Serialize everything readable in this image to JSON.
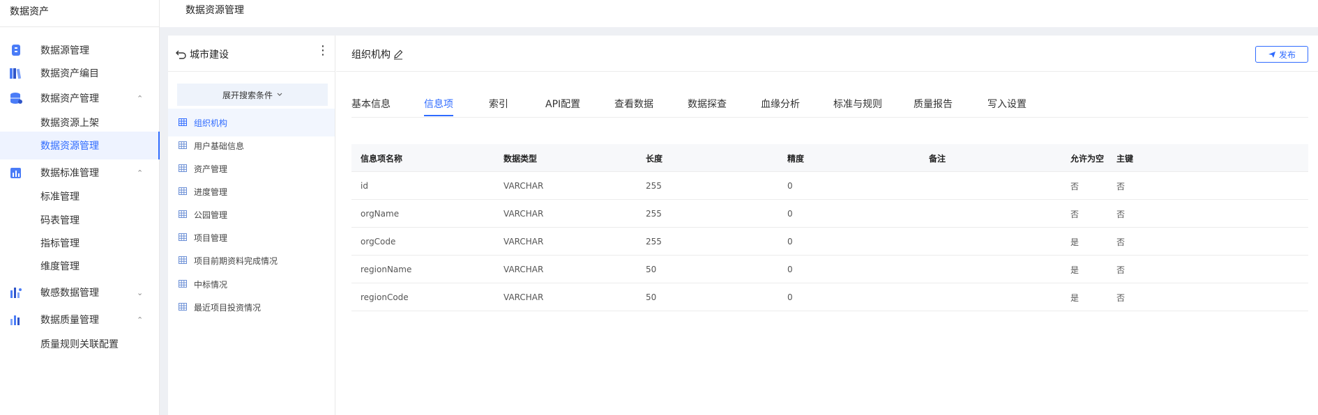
{
  "sidebar": {
    "header": "数据资产",
    "items": [
      {
        "label": "数据源管理",
        "icon": "database-server-icon",
        "arrow": ""
      },
      {
        "label": "数据资产编目",
        "icon": "catalog-books-icon",
        "arrow": ""
      },
      {
        "label": "数据资产管理",
        "icon": "database-stack-icon",
        "arrow": "⌃"
      },
      {
        "label": "数据资源上架",
        "sub": true
      },
      {
        "label": "数据资源管理",
        "sub": true,
        "active": true
      },
      {
        "label": "数据标准管理",
        "icon": "bar-chart-icon",
        "arrow": "⌃"
      },
      {
        "label": "标准管理",
        "sub": true
      },
      {
        "label": "码表管理",
        "sub": true
      },
      {
        "label": "指标管理",
        "sub": true
      },
      {
        "label": "维度管理",
        "sub": true
      },
      {
        "label": "敏感数据管理",
        "icon": "sensitive-data-icon",
        "arrow": "⌄"
      },
      {
        "label": "数据质量管理",
        "icon": "quality-chart-icon",
        "arrow": "⌃"
      },
      {
        "label": "质量规则关联配置",
        "sub": true
      }
    ]
  },
  "topbar": {
    "title": "数据资源管理"
  },
  "tree": {
    "back_label": "城市建设",
    "more": "⋮",
    "expand_label": "展开搜索条件",
    "items": [
      {
        "label": "组织机构",
        "active": true
      },
      {
        "label": "用户基础信息"
      },
      {
        "label": "资产管理"
      },
      {
        "label": "进度管理"
      },
      {
        "label": "公园管理"
      },
      {
        "label": "项目管理"
      },
      {
        "label": "项目前期资料完成情况"
      },
      {
        "label": "中标情况"
      },
      {
        "label": "最近项目投资情况"
      }
    ]
  },
  "main": {
    "title": "组织机构",
    "publish_label": "发布",
    "tabs": [
      "基本信息",
      "信息项",
      "索引",
      "API配置",
      "查看数据",
      "数据探查",
      "血缘分析",
      "标准与规则",
      "质量报告",
      "写入设置"
    ],
    "active_tab": 1,
    "table": {
      "columns": [
        "信息项名称",
        "数据类型",
        "长度",
        "精度",
        "备注",
        "允许为空",
        "主键"
      ],
      "rows": [
        [
          "id",
          "VARCHAR",
          "255",
          "0",
          "",
          "否",
          "否"
        ],
        [
          "orgName",
          "VARCHAR",
          "255",
          "0",
          "",
          "否",
          "否"
        ],
        [
          "orgCode",
          "VARCHAR",
          "255",
          "0",
          "",
          "是",
          "否"
        ],
        [
          "regionName",
          "VARCHAR",
          "50",
          "0",
          "",
          "是",
          "否"
        ],
        [
          "regionCode",
          "VARCHAR",
          "50",
          "0",
          "",
          "是",
          "否"
        ]
      ]
    }
  },
  "colors": {
    "accent": "#2f6bff",
    "background_gray": "#eef0f4"
  }
}
